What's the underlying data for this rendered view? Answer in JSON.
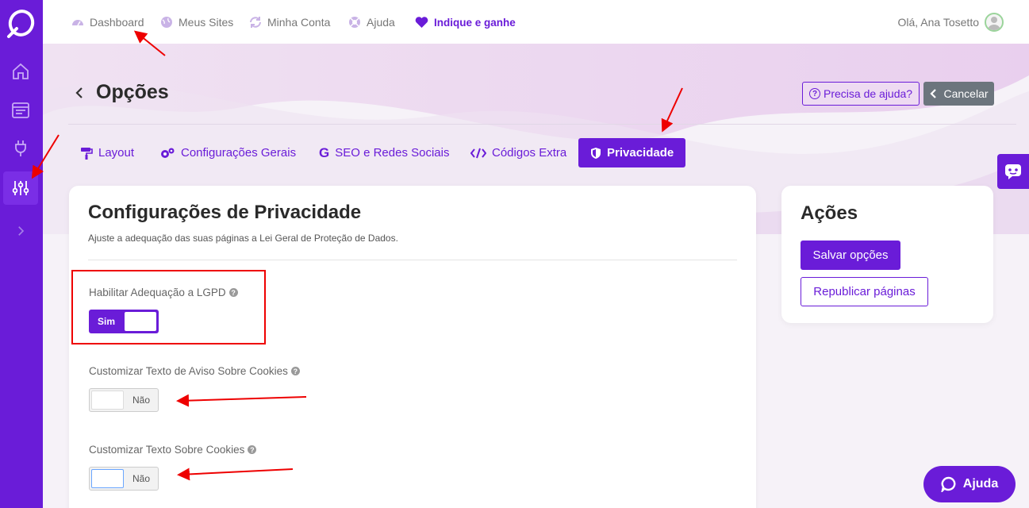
{
  "nav": {
    "items": [
      {
        "label": "Dashboard",
        "icon": "dashboard-icon"
      },
      {
        "label": "Meus Sites",
        "icon": "globe-icon"
      },
      {
        "label": "Minha Conta",
        "icon": "sync-icon"
      },
      {
        "label": "Ajuda",
        "icon": "lifebuoy-icon"
      }
    ],
    "referral": "Indique e ganhe",
    "greeting": "Olá, Ana Tosetto"
  },
  "page": {
    "title": "Opções",
    "help_label": "Precisa de ajuda?",
    "cancel_label": "Cancelar"
  },
  "tabs": [
    {
      "label": "Layout",
      "icon": "paint-roller-icon"
    },
    {
      "label": "Configurações Gerais",
      "icon": "gears-icon"
    },
    {
      "label": "SEO e Redes Sociais",
      "icon": "google-icon"
    },
    {
      "label": "Códigos Extra",
      "icon": "code-icon"
    },
    {
      "label": "Privacidade",
      "icon": "shield-icon",
      "active": true
    }
  ],
  "privacy": {
    "title": "Configurações de Privacidade",
    "subtitle": "Ajuste a adequação das suas páginas a Lei Geral de Proteção de Dados.",
    "fields": [
      {
        "label": "Habilitar Adequação a LGPD",
        "state": "Sim",
        "on": true
      },
      {
        "label": "Customizar Texto de Aviso Sobre Cookies",
        "state": "Não",
        "on": false
      },
      {
        "label": "Customizar Texto Sobre Cookies",
        "state": "Não",
        "on": false
      }
    ]
  },
  "actions": {
    "title": "Ações",
    "save_label": "Salvar opções",
    "republish_label": "Republicar páginas"
  },
  "help_fab": {
    "label": "Ajuda"
  },
  "colors": {
    "brand": "#6a1cd8",
    "annotation": "#e00000"
  }
}
